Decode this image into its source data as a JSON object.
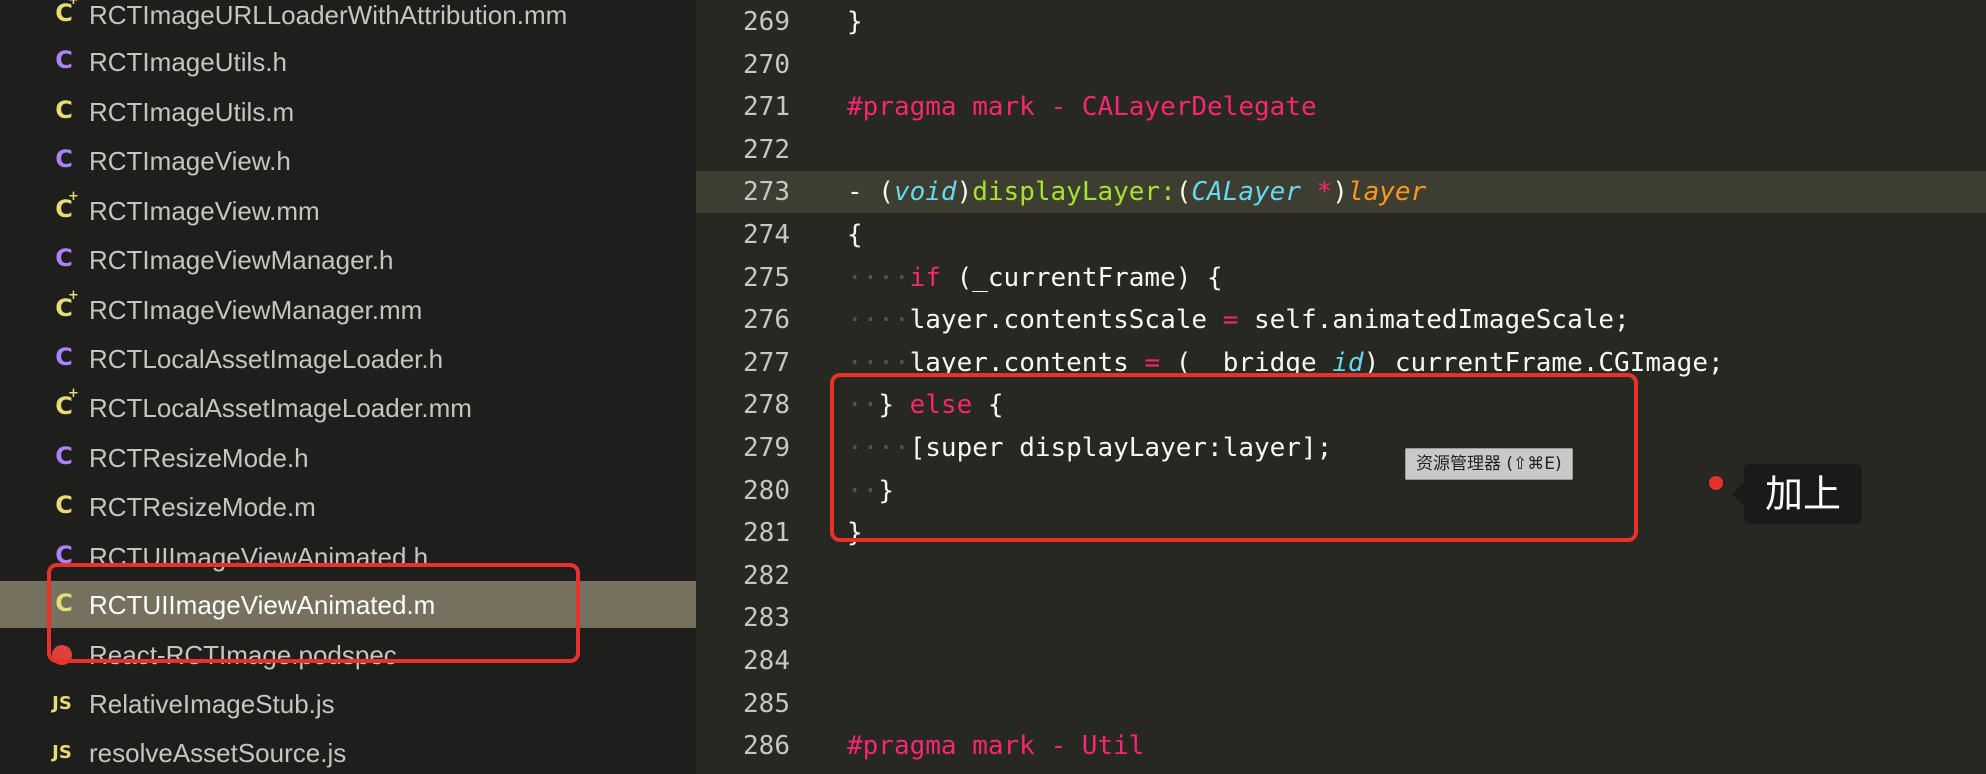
{
  "sidebar": {
    "files": [
      {
        "name": "RCTImageURLLoaderWithAttribution.mm",
        "icon": "c-plus-icon",
        "icon_text": "C",
        "color": "#e6db74"
      },
      {
        "name": "RCTImageUtils.h",
        "icon": "c-header-icon",
        "icon_text": "C",
        "color": "#ae81ff"
      },
      {
        "name": "RCTImageUtils.m",
        "icon": "c-source-icon",
        "icon_text": "C",
        "color": "#e6db74"
      },
      {
        "name": "RCTImageView.h",
        "icon": "c-header-icon",
        "icon_text": "C",
        "color": "#ae81ff"
      },
      {
        "name": "RCTImageView.mm",
        "icon": "c-plus-icon",
        "icon_text": "C",
        "color": "#e6db74"
      },
      {
        "name": "RCTImageViewManager.h",
        "icon": "c-header-icon",
        "icon_text": "C",
        "color": "#ae81ff"
      },
      {
        "name": "RCTImageViewManager.mm",
        "icon": "c-plus-icon",
        "icon_text": "C",
        "color": "#e6db74"
      },
      {
        "name": "RCTLocalAssetImageLoader.h",
        "icon": "c-header-icon",
        "icon_text": "C",
        "color": "#ae81ff"
      },
      {
        "name": "RCTLocalAssetImageLoader.mm",
        "icon": "c-plus-icon",
        "icon_text": "C",
        "color": "#e6db74"
      },
      {
        "name": "RCTResizeMode.h",
        "icon": "c-header-icon",
        "icon_text": "C",
        "color": "#ae81ff"
      },
      {
        "name": "RCTResizeMode.m",
        "icon": "c-source-icon",
        "icon_text": "C",
        "color": "#e6db74"
      },
      {
        "name": "RCTUIImageViewAnimated.h",
        "icon": "c-header-icon",
        "icon_text": "C",
        "color": "#ae81ff"
      },
      {
        "name": "RCTUIImageViewAnimated.m",
        "icon": "c-source-icon",
        "icon_text": "C",
        "color": "#e6db74",
        "selected": true
      },
      {
        "name": "React-RCTImage.podspec",
        "icon": "podspec-icon",
        "icon_text": "",
        "color": "#e0403a"
      },
      {
        "name": "RelativeImageStub.js",
        "icon": "js-icon",
        "icon_text": "JS",
        "color": "#e6db74"
      },
      {
        "name": "resolveAssetSource.js",
        "icon": "js-icon",
        "icon_text": "JS",
        "color": "#e6db74"
      }
    ]
  },
  "editor": {
    "current_line": "273",
    "lines": [
      {
        "number": "269",
        "tokens": [
          [
            "plain",
            "}"
          ]
        ]
      },
      {
        "number": "270",
        "tokens": []
      },
      {
        "number": "271",
        "tokens": [
          [
            "pragma",
            "#pragma mark - CALayerDelegate"
          ]
        ]
      },
      {
        "number": "272",
        "tokens": []
      },
      {
        "number": "273",
        "tokens": [
          [
            "plain",
            "- ("
          ],
          [
            "type",
            "void"
          ],
          [
            "plain",
            ")"
          ],
          [
            "func",
            "displayLayer:"
          ],
          [
            "plain",
            "("
          ],
          [
            "type",
            "CALayer"
          ],
          [
            "plain",
            " "
          ],
          [
            "op",
            "*"
          ],
          [
            "plain",
            ")"
          ],
          [
            "param",
            "layer"
          ]
        ]
      },
      {
        "number": "274",
        "tokens": [
          [
            "plain",
            "{"
          ]
        ]
      },
      {
        "number": "275",
        "tokens": [
          [
            "ws",
            "····"
          ],
          [
            "keyword",
            "if"
          ],
          [
            "plain",
            " (_currentFrame) {"
          ]
        ]
      },
      {
        "number": "276",
        "tokens": [
          [
            "ws",
            "····"
          ],
          [
            "plain",
            "layer.contentsScale "
          ],
          [
            "op",
            "="
          ],
          [
            "plain",
            " self.animatedImageScale;"
          ]
        ]
      },
      {
        "number": "277",
        "tokens": [
          [
            "ws",
            "····"
          ],
          [
            "plain",
            "layer.contents "
          ],
          [
            "op",
            "="
          ],
          [
            "plain",
            " (__bridge "
          ],
          [
            "type",
            "id"
          ],
          [
            "plain",
            ")_currentFrame.CGImage;"
          ]
        ]
      },
      {
        "number": "278",
        "tokens": [
          [
            "ws",
            "··"
          ],
          [
            "plain",
            "} "
          ],
          [
            "keyword",
            "else"
          ],
          [
            "plain",
            " {"
          ]
        ]
      },
      {
        "number": "279",
        "tokens": [
          [
            "ws",
            "····"
          ],
          [
            "plain",
            "[super displayLayer:layer];"
          ]
        ]
      },
      {
        "number": "280",
        "tokens": [
          [
            "ws",
            "··"
          ],
          [
            "plain",
            "}"
          ]
        ]
      },
      {
        "number": "281",
        "tokens": [
          [
            "plain",
            "}"
          ]
        ]
      },
      {
        "number": "282",
        "tokens": []
      },
      {
        "number": "283",
        "tokens": []
      },
      {
        "number": "284",
        "tokens": []
      },
      {
        "number": "285",
        "tokens": []
      },
      {
        "number": "286",
        "tokens": [
          [
            "pragma",
            "#pragma mark - Util"
          ]
        ]
      }
    ]
  },
  "tooltip": {
    "text": "资源管理器 (⇧⌘E)"
  },
  "annotation": {
    "label": "加上",
    "color": "#e8312b"
  },
  "colors": {
    "editor_bg": "#272822",
    "sidebar_bg": "#1e1f1c",
    "selection_bg": "#75715e",
    "current_line_bg": "#3e3d32"
  }
}
